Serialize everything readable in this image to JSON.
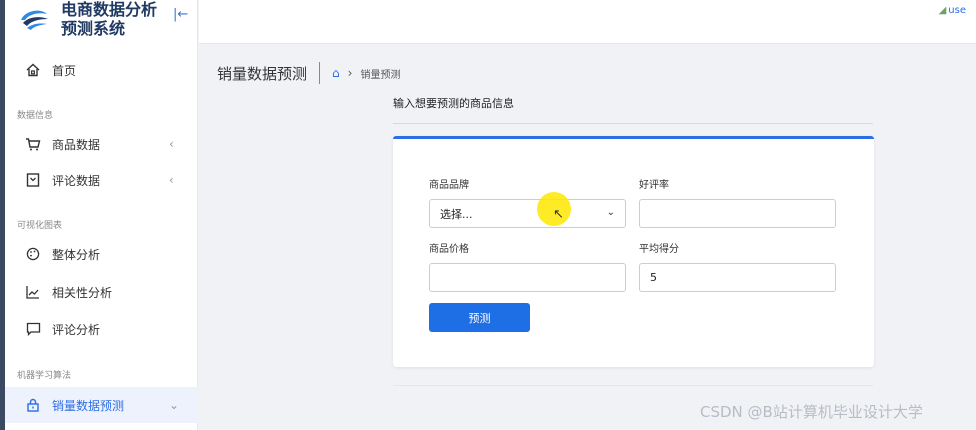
{
  "brand": {
    "title_line1": "电商数据分析",
    "title_line2": "预测系统"
  },
  "user": {
    "label": "use"
  },
  "sidebar": {
    "home": "首页",
    "section_data": "数据信息",
    "product_data": "商品数据",
    "review_data": "评论数据",
    "section_charts": "可视化图表",
    "overall_analysis": "整体分析",
    "correlation_analysis": "相关性分析",
    "review_analysis": "评论分析",
    "section_ml": "机器学习算法",
    "sales_prediction": "销量数据预测"
  },
  "page": {
    "title": "销量数据预测",
    "breadcrumb_current": "销量预测",
    "form_heading": "输入想要预测的商品信息"
  },
  "form": {
    "brand_label": "商品品牌",
    "brand_value": "选择...",
    "rating_label": "好评率",
    "rating_value": "",
    "price_label": "商品价格",
    "price_value": "",
    "score_label": "平均得分",
    "score_value": "5",
    "submit_label": "预测"
  },
  "watermark": "CSDN @B站计算机毕业设计大学",
  "colors": {
    "accent": "#1e6fe6",
    "sidebar_strip": "#3b4a63",
    "active_bg": "#edf2fd"
  }
}
